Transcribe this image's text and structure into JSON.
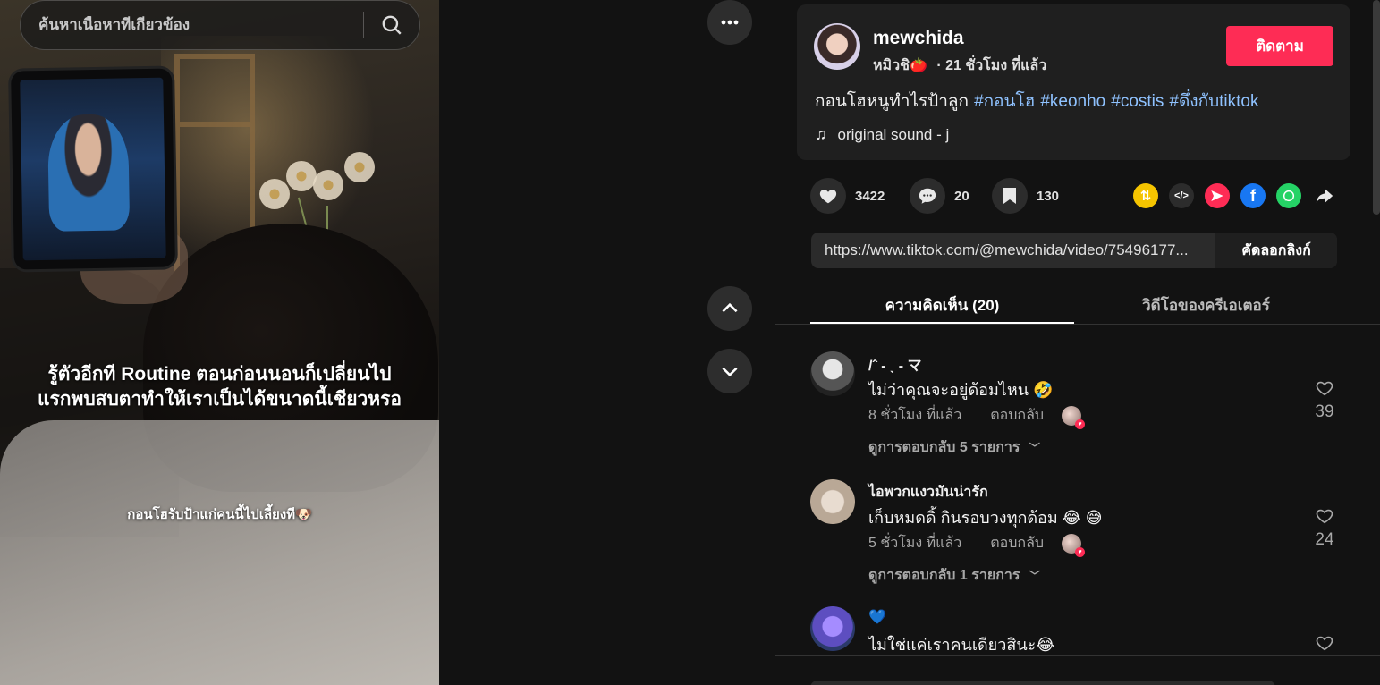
{
  "search": {
    "placeholder": "ค้นหาเนื้อหาที่เกี่ยวข้อง"
  },
  "video": {
    "overlay_line1": "รู้ตัวอีกที Routine ตอนก่อนนอนก็เปลี่ยนไป",
    "overlay_line2": "แรกพบสบตาทำให้เราเป็นได้ขนาดนี้เชียวหรอ",
    "overlay_caption": "กอนโฮรับป้าแก่คนนี้ไปเลี้ยงที🐶"
  },
  "controls": {
    "more_icon": "more-horizontal-icon",
    "up_icon": "chevron-up-icon",
    "down_icon": "chevron-down-icon"
  },
  "post": {
    "username": "mewchida",
    "nickname": "หมิวชิ🍅",
    "time": "· 21 ชั่วโมง ที่แล้ว",
    "follow_label": "ติดตาม",
    "description": "กอนโฮหนูทำไรป้าลูก",
    "hashtags": [
      "#กอนโฮ",
      "#keonho",
      "#costis",
      "#ดึ่งกับtiktok"
    ],
    "sound": "original sound - j"
  },
  "actions": {
    "likes": "3422",
    "comments": "20",
    "saves": "130"
  },
  "share": {
    "colors": {
      "repost": "#f5c400",
      "embed": "#2c2c2c",
      "send": "#fe2c55",
      "facebook": "#1877f2",
      "whatsapp": "#25d366"
    }
  },
  "link": {
    "url": "https://www.tiktok.com/@mewchida/video/75496177...",
    "copy_label": "คัดลอกลิงก์"
  },
  "tabs": {
    "comments": "ความคิดเห็น (20)",
    "creator_videos": "วิดีโอของครีเอเตอร์"
  },
  "comments": [
    {
      "name": "/ˆ - ˎ - マ",
      "text": "ไม่ว่าคุณจะอยู่ด้อมไหน 🤣",
      "time": "8 ชั่วโมง ที่แล้ว",
      "reply": "ตอบกลับ",
      "view_replies": "ดูการตอบกลับ 5 รายการ",
      "likes": "39"
    },
    {
      "name": "ไอพวกแงวมันน่ารัก",
      "text": "เก็บหมดดิ้ กินรอบวงทุกด้อม 😂 😅",
      "time": "5 ชั่วโมง ที่แล้ว",
      "reply": "ตอบกลับ",
      "view_replies": "ดูการตอบกลับ 1 รายการ",
      "likes": "24"
    },
    {
      "name": "💙",
      "text": "ไม่ใช่แค่เราคนเดียวสินะ😂"
    }
  ]
}
